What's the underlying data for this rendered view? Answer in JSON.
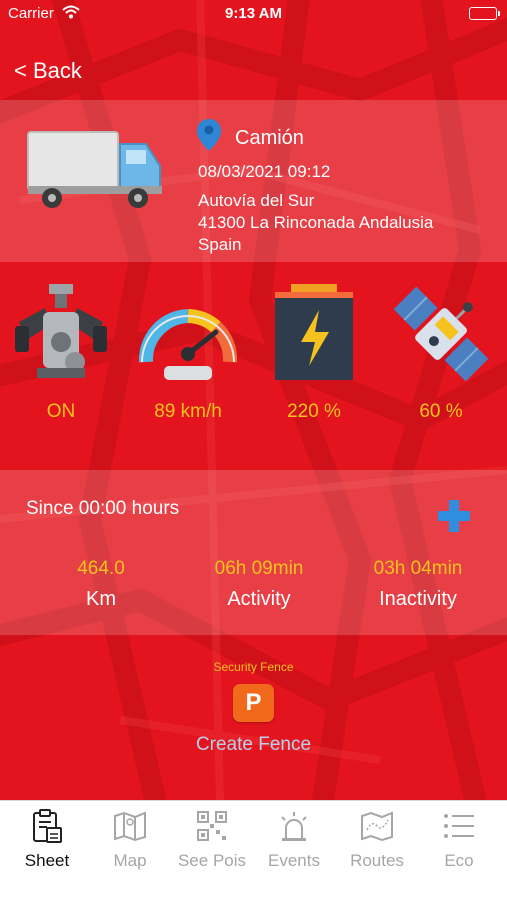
{
  "status_bar": {
    "carrier": "Carrier",
    "time": "9:13 AM"
  },
  "nav": {
    "back_label": "< Back"
  },
  "vehicle": {
    "name": "Camión",
    "datetime": "08/03/2021 09:12",
    "address_line1": "Autovía del Sur",
    "address_line2": "41300 La Rinconada Andalusia",
    "address_line3": "Spain"
  },
  "gauges": [
    {
      "icon": "engine-icon",
      "value": "ON"
    },
    {
      "icon": "speedometer-icon",
      "value": "89 km/h"
    },
    {
      "icon": "battery-icon",
      "value": "220 %"
    },
    {
      "icon": "satellite-icon",
      "value": "60 %"
    }
  ],
  "summary": {
    "since": "Since 00:00 hours",
    "stats": [
      {
        "value": "464.0",
        "label": "Km"
      },
      {
        "value": "06h 09min",
        "label": "Activity"
      },
      {
        "value": "03h 04min",
        "label": "Inactivity"
      }
    ]
  },
  "fence": {
    "label": "Security Fence",
    "parking_letter": "P",
    "create_label": "Create Fence"
  },
  "tabs": [
    {
      "label": "Sheet",
      "icon": "sheet-icon",
      "active": true
    },
    {
      "label": "Map",
      "icon": "map-icon",
      "active": false
    },
    {
      "label": "See Pois",
      "icon": "qr-icon",
      "active": false
    },
    {
      "label": "Events",
      "icon": "alarm-icon",
      "active": false
    },
    {
      "label": "Routes",
      "icon": "routes-icon",
      "active": false
    },
    {
      "label": "Eco",
      "icon": "list-icon",
      "active": false
    }
  ],
  "colors": {
    "background": "#e3141d",
    "accent_value": "#f6c21d",
    "link": "#b9d1ee",
    "plus": "#2f8ee0",
    "parking": "#f16a1c"
  }
}
